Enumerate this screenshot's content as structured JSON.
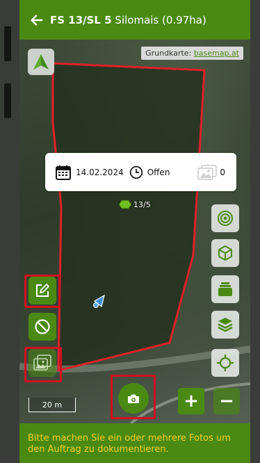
{
  "header": {
    "back_icon": "arrow-left-icon",
    "title_bold": "FS 13/SL 5",
    "title_rest": " Silomais (0.97ha)"
  },
  "map": {
    "basemap_prefix": "Grundkarte: ",
    "basemap_link": "basemap.at",
    "field_label": "13/5",
    "scale_label": "20 m"
  },
  "info_card": {
    "date": "14.02.2024",
    "status": "Offen",
    "photo_count": "0"
  },
  "right_buttons": [
    "target-icon",
    "cube-icon",
    "cards-icon",
    "layers-icon",
    "crosshair-icon"
  ],
  "left_buttons": [
    "edit-icon",
    "block-icon",
    "gallery-icon"
  ],
  "zoom": {
    "in_label": "+",
    "out_label": "−"
  },
  "footer": {
    "message": "Bitte machen Sie ein oder mehrere Fotos um den Auftrag zu dokumentieren."
  },
  "colors": {
    "brand": "#4a8a13",
    "highlight": "#d31020",
    "footer_text": "#f3cf2a",
    "field_outline": "#e0202a"
  }
}
